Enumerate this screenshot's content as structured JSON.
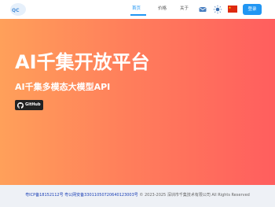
{
  "header": {
    "logo_icon": "logo-icon",
    "nav": {
      "home": "首页",
      "price": "价格",
      "about": "关于"
    },
    "icons": [
      "mail-icon",
      "theme-toggle-icon",
      "china-flag-icon"
    ],
    "login_label": "登录",
    "accent_color": "#2196f3"
  },
  "hero": {
    "title": "AI千集开放平台",
    "subtitle": "AI千集多模态大模型API",
    "github_label": "GitHub",
    "gradient": [
      "#ffa05a",
      "#ff5e5e"
    ]
  },
  "footer": {
    "icp": "粤ICP备18152112号",
    "police": "粤公网安备33011050720640123003号",
    "copyright": "© 2023-2025 深圳市千集技术有限公司 All Rights Reserved"
  }
}
